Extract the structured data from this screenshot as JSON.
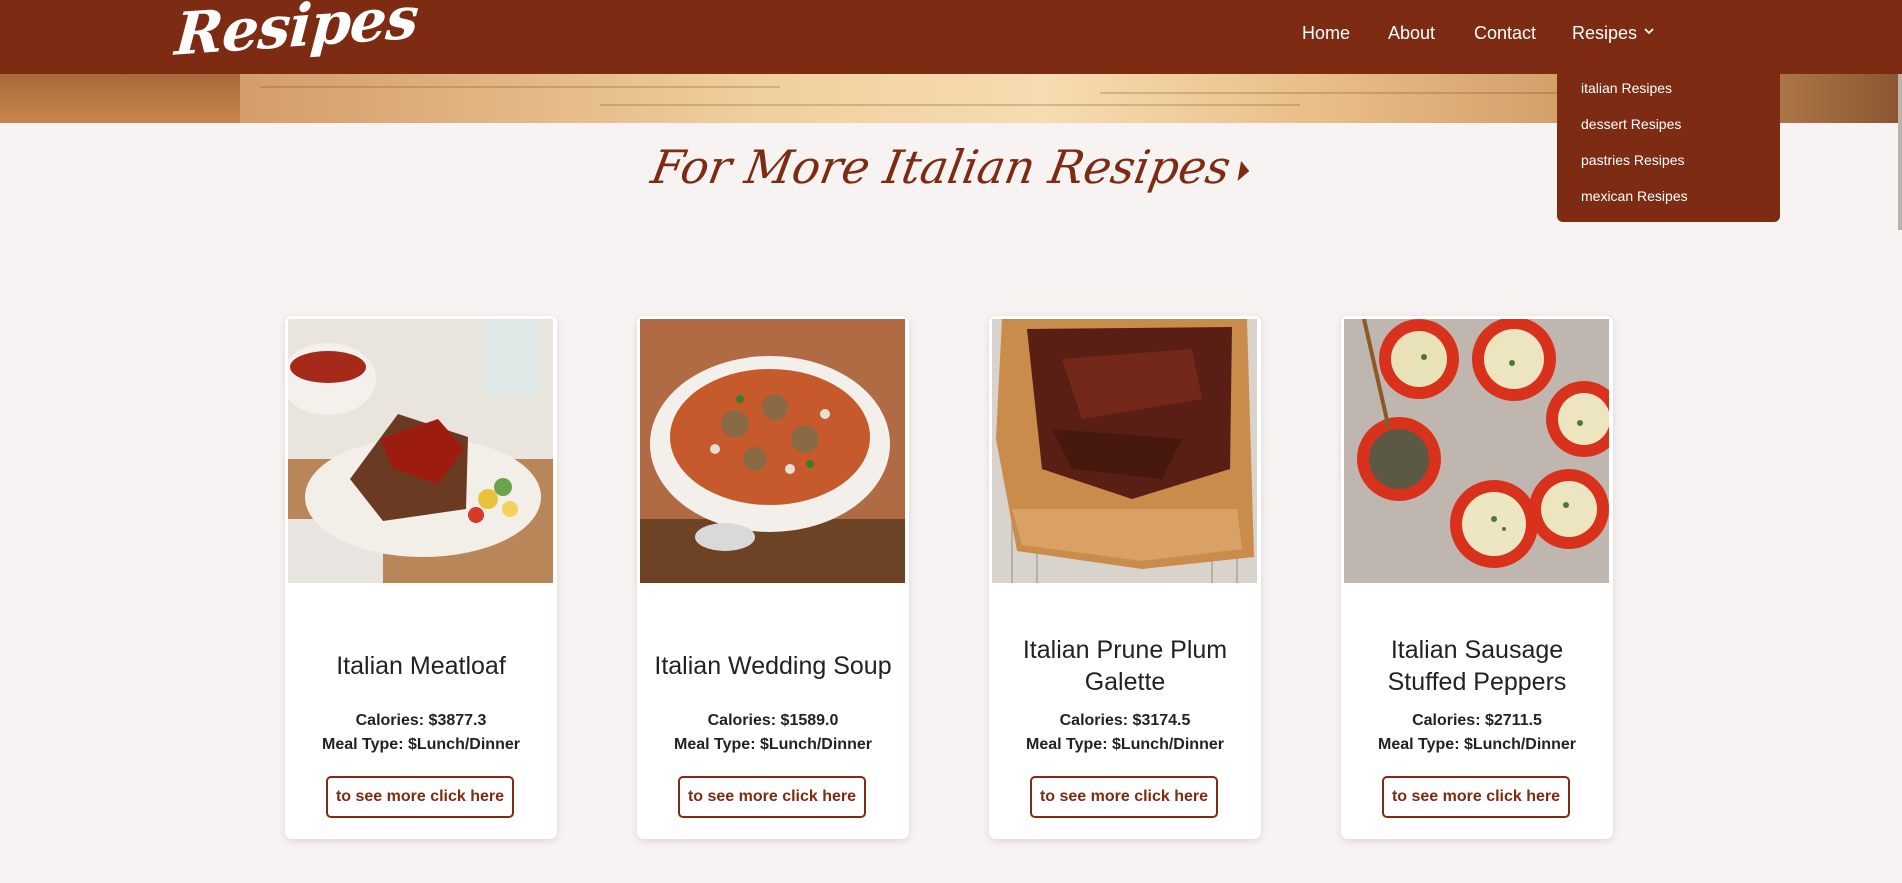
{
  "brand": "Resipes",
  "nav": {
    "home": "Home",
    "about": "About",
    "contact": "Contact",
    "resipes": "Resipes"
  },
  "dropdown": {
    "items": [
      "italian Resipes",
      "dessert Resipes",
      "pastries Resipes",
      "mexican Resipes"
    ]
  },
  "headline": "For More Italian Resipes",
  "cards": [
    {
      "title": "Italian Meatloaf",
      "calories": "Calories: $3877.3",
      "meal_type": "Meal Type: $Lunch/Dinner",
      "button": "to see more click here"
    },
    {
      "title": "Italian Wedding Soup",
      "calories": "Calories: $1589.0",
      "meal_type": "Meal Type: $Lunch/Dinner",
      "button": "to see more click here"
    },
    {
      "title": "Italian Prune Plum Galette",
      "calories": "Calories: $3174.5",
      "meal_type": "Meal Type: $Lunch/Dinner",
      "button": "to see more click here"
    },
    {
      "title": "Italian Sausage Stuffed Peppers",
      "calories": "Calories: $2711.5",
      "meal_type": "Meal Type: $Lunch/Dinner",
      "button": "to see more click here"
    }
  ],
  "colors": {
    "brand": "#7e2b13",
    "background": "#f7f3f2",
    "card": "#ffffff"
  }
}
